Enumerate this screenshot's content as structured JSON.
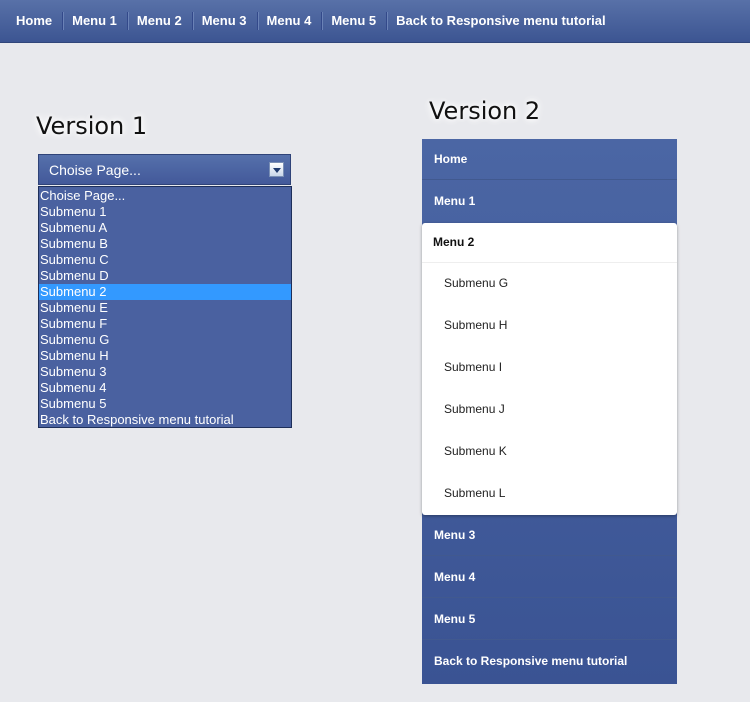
{
  "topnav": {
    "items": [
      "Home",
      "Menu 1",
      "Menu 2",
      "Menu 3",
      "Menu 4",
      "Menu 5",
      "Back to Responsive menu tutorial"
    ]
  },
  "version1": {
    "title": "Version 1",
    "select_value": "Choise Page...",
    "options": [
      "Choise Page...",
      "Submenu 1",
      "Submenu A",
      "Submenu B",
      "Submenu C",
      "Submenu D",
      "Submenu 2",
      "Submenu E",
      "Submenu F",
      "Submenu G",
      "Submenu H",
      "Submenu 3",
      "Submenu 4",
      "Submenu 5",
      "Back to Responsive menu tutorial"
    ],
    "highlighted_option": "Submenu 2"
  },
  "version2": {
    "title": "Version 2",
    "items_top": [
      "Home",
      "Menu 1"
    ],
    "open_item": "Menu 2",
    "submenu": [
      "Submenu G",
      "Submenu H",
      "Submenu I",
      "Submenu J",
      "Submenu K",
      "Submenu L"
    ],
    "items_bottom": [
      "Menu 3",
      "Menu 4",
      "Menu 5",
      "Back to Responsive menu tutorial"
    ]
  },
  "colors": {
    "nav_bg": "#4a63a0",
    "page_bg": "#e8e9ed",
    "selected_option": "#3399ff"
  }
}
